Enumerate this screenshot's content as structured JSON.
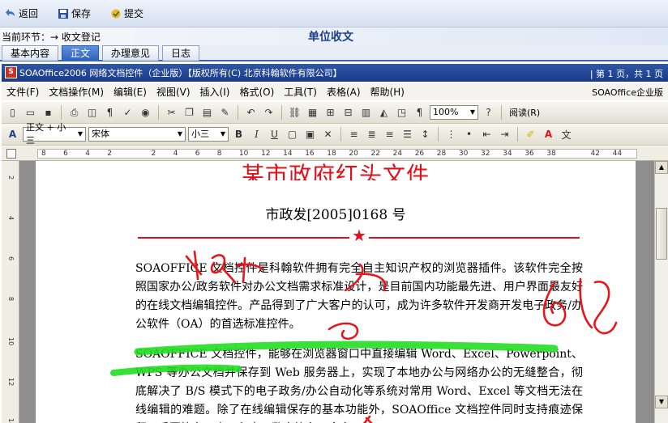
{
  "actions": {
    "back": "返回",
    "save": "保存",
    "submit": "提交"
  },
  "step": {
    "label": "当前环节：→ 收文登记"
  },
  "unit_title": "单位收文",
  "tabs": [
    "基本内容",
    "正文",
    "办理意见",
    "日志"
  ],
  "active_tab_index": 1,
  "office": {
    "title": "SOAOffice2006 网络文档控件（企业版）【版权所有(C) 北京科翰软件有限公司】",
    "page_info": "| 第 1 页，共 1 页",
    "brand": "SOAOffice企业版",
    "logo": "S"
  },
  "menu": [
    "文件(F)",
    "文档操作(M)",
    "编辑(E)",
    "视图(V)",
    "插入(I)",
    "格式(O)",
    "工具(T)",
    "表格(A)",
    "帮助(H)"
  ],
  "toolbar1": {
    "zoom": "100%",
    "read_label": "阅读(R)"
  },
  "toolbar2": {
    "style": "正文 + 小三",
    "font": "宋体",
    "size": "小三"
  },
  "ruler_ticks": [
    "8",
    "6",
    "4",
    "2",
    "",
    "2",
    "4",
    "6",
    "8",
    "10",
    "12",
    "14",
    "16",
    "18",
    "20",
    "22",
    "24",
    "26",
    "28",
    "30",
    "32",
    "34",
    "36",
    "38",
    "",
    "42",
    "44"
  ],
  "vruler_ticks": [
    "2",
    "",
    "4",
    "",
    "6",
    "",
    "8",
    "",
    "10",
    "",
    "12",
    "",
    "14"
  ],
  "document": {
    "header_title": "某市政府红头文件",
    "doc_number": "市政发[2005]0168 号",
    "para1": "SOAOFFICE 文档控件是科翰软件拥有完全自主知识产权的浏览器插件。该软件完全按照国家办公/政务软件对办公文档需求标准设计，是目前国内功能最先进、用户界面最友好的在线文档编辑控件。产品得到了广大客户的认可，成为许多软件开发商开发电子政务/办公软件（OA）的首选标准控件。",
    "para2": "SOAOFFICE 文档控件，能够在浏览器窗口中直接编辑 Word、Excel、Powerpoint、WPS 等办公文档并保存到 Web 服务器上，实现了本地办公与网络办公的无缝整合，彻底解决了 B/S 模式下的电子政务/办公自动化等系统对常用 Word、Excel 等文档无法在线编辑的难题。除了在线编辑保存的基本功能外，SOAOffice 文档控件同时支持痕迹保留、手写签名、电子印章、数字签名、全文"
  },
  "colors": {
    "accent": "#1c3f8c",
    "header_red": "#e0101a",
    "ink_red": "#e8161c",
    "highlight_green": "#22dd22"
  },
  "icons": [
    "back-icon",
    "save-icon",
    "submit-icon"
  ]
}
